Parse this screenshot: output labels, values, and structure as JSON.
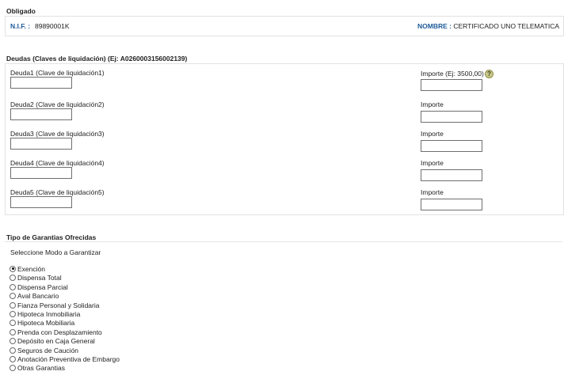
{
  "obligado": {
    "title": "Obligado",
    "nif_label": "N.I.F. :",
    "nif_value": "89890001K",
    "nombre_label": "NOMBRE :",
    "nombre_value": "CERTIFICADO UNO TELEMATICA"
  },
  "deudas": {
    "title": "Deudas (Claves de liquidación) (Ej: A0260003156002139)",
    "rows": [
      {
        "label": "Deuda1 (Clave de liquidación1)",
        "importe_label": "Importe (Ej: 3500,00)",
        "value": "",
        "importe": ""
      },
      {
        "label": "Deuda2 (Clave de liquidación2)",
        "importe_label": "Importe",
        "value": "",
        "importe": ""
      },
      {
        "label": "Deuda3 (Clave de liquidación3)",
        "importe_label": "Importe",
        "value": "",
        "importe": ""
      },
      {
        "label": "Deuda4 (Clave de liquidación4)",
        "importe_label": "Importe",
        "value": "",
        "importe": ""
      },
      {
        "label": "Deuda5 (Clave de liquidación5)",
        "importe_label": "Importe",
        "value": "",
        "importe": ""
      }
    ],
    "help_glyph": "?"
  },
  "garantias": {
    "title": "Tipo de Garantias Ofrecidas",
    "instruction": "Seleccione Modo a Garantizar",
    "selected": "Exención",
    "options": [
      "Exención",
      "Dispensa Total",
      "Dispensa Parcial",
      "Aval Bancario",
      "Fianza Personal y Solidaria",
      "Hipoteca Inmobiliaria",
      "Hipoteca Mobiliaria",
      "Prenda con Desplazamiento",
      "Depósito en Caja General",
      "Seguros de Caución",
      "Anotación Preventiva de Embargo",
      "Otras Garantias"
    ]
  }
}
